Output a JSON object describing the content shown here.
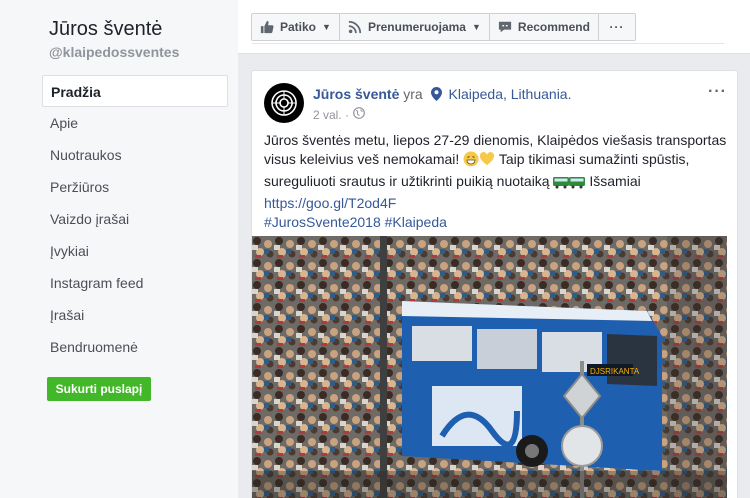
{
  "sidebar": {
    "page_name": "Jūros šventė",
    "handle": "@klaipedossventes",
    "nav": [
      {
        "label": "Pradžia"
      },
      {
        "label": "Apie"
      },
      {
        "label": "Nuotraukos"
      },
      {
        "label": "Peržiūros"
      },
      {
        "label": "Vaizdo įrašai"
      },
      {
        "label": "Įvykiai"
      },
      {
        "label": "Instagram feed"
      },
      {
        "label": "Įrašai"
      },
      {
        "label": "Bendruomenė"
      }
    ],
    "create_button": "Sukurti puslapį"
  },
  "toolbar": {
    "like_label": "Patiko",
    "follow_label": "Prenumeruojama",
    "recommend_label": "Recommend",
    "more_label": "···"
  },
  "post": {
    "author": "Jūros šventė",
    "verb": "yra",
    "location": "Klaipeda, Lithuania.",
    "time": "2 val.",
    "more_label": "···",
    "text_1": "Jūros šventės metu, liepos 27-29 dienomis, Klaipėdos viešasis transportas visus keleivius veš nemokamai!",
    "text_2": "Taip tikimasi sumažinti spūstis, sureguliuoti srautus ir užtikrinti puikią nuotaiką",
    "text_3": "Išsamiai",
    "url": "https://goo.gl/T2od4F",
    "hashtags": "#JurosSvente2018 #Klaipeda",
    "bus_sign": "DJSRIKANTA"
  },
  "colors": {
    "link": "#365899",
    "green": "#42b72a",
    "bus_blue": "#1e5fb0"
  }
}
